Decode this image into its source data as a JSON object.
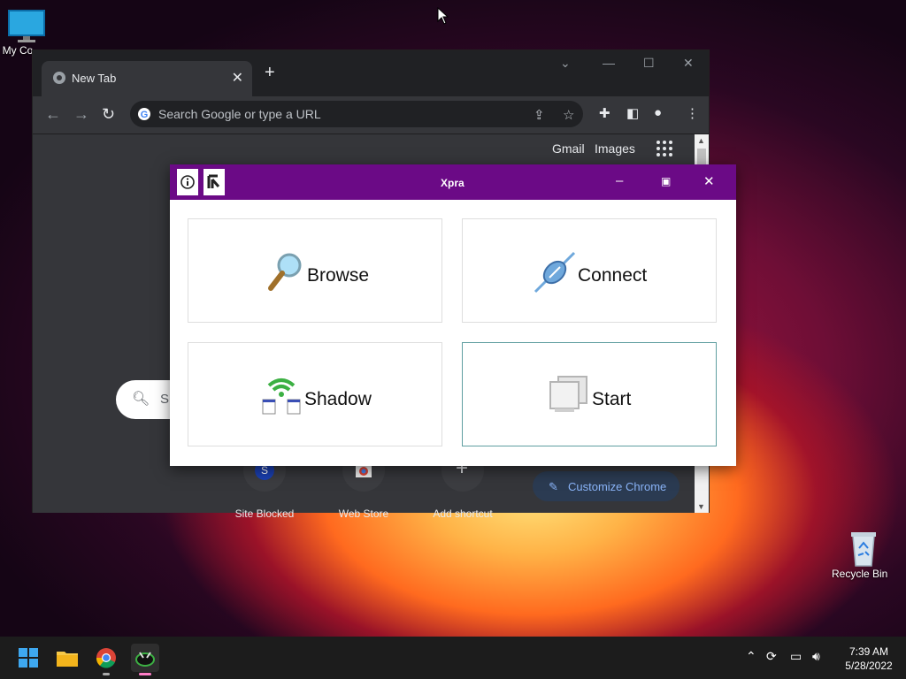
{
  "desktop": {
    "icons": [
      {
        "label": "My Co"
      },
      {
        "label": "Recycle Bin"
      }
    ]
  },
  "chrome": {
    "tab_title": "New Tab",
    "omnibox_placeholder": "Search Google or type a URL",
    "header_links": {
      "gmail": "Gmail",
      "images": "Images"
    },
    "search_pill_text": "S",
    "shortcuts": [
      {
        "label": "Site Blocked",
        "badge": "S"
      },
      {
        "label": "Web Store"
      },
      {
        "label": "Add shortcut",
        "glyph": "+"
      }
    ],
    "customize_label": "Customize Chrome"
  },
  "xpra": {
    "title": "Xpra",
    "tiles": [
      {
        "label": "Browse",
        "icon": "magnifier-icon"
      },
      {
        "label": "Connect",
        "icon": "plug-icon"
      },
      {
        "label": "Shadow",
        "icon": "wifi-screens-icon"
      },
      {
        "label": "Start",
        "icon": "windows-stack-icon"
      }
    ]
  },
  "taskbar": {
    "time": "7:39 AM",
    "date": "5/28/2022"
  },
  "colors": {
    "xpra_titlebar": "#6b0a86",
    "chrome_dark": "#35363a",
    "accent_blue": "#8ab4f8"
  }
}
